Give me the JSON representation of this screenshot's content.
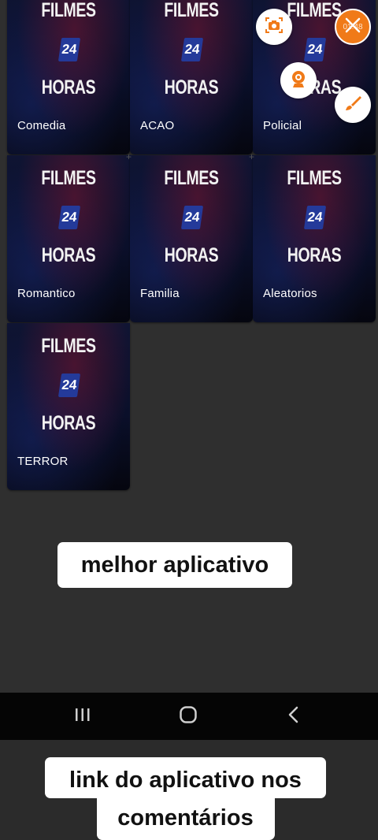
{
  "categories": [
    {
      "label": "Comedia"
    },
    {
      "label": "ACAO"
    },
    {
      "label": "Policial"
    },
    {
      "label": "Romantico"
    },
    {
      "label": "Familia"
    },
    {
      "label": "Aleatorios"
    },
    {
      "label": "TERROR"
    }
  ],
  "poster": {
    "line1": "FILMES",
    "badge": "24",
    "line2": "HORAS"
  },
  "recorder": {
    "timer": "01:48"
  },
  "captions": {
    "top": "melhor aplicativo",
    "bottom": "link do aplicativo nos comentários"
  },
  "colors": {
    "background": "#2f2f2f",
    "accent": "#f07a18",
    "badge": "#243a9a"
  },
  "icons": [
    "camera-icon",
    "close-icon",
    "webcam-icon",
    "brush-icon",
    "recents-icon",
    "home-icon",
    "back-icon"
  ]
}
